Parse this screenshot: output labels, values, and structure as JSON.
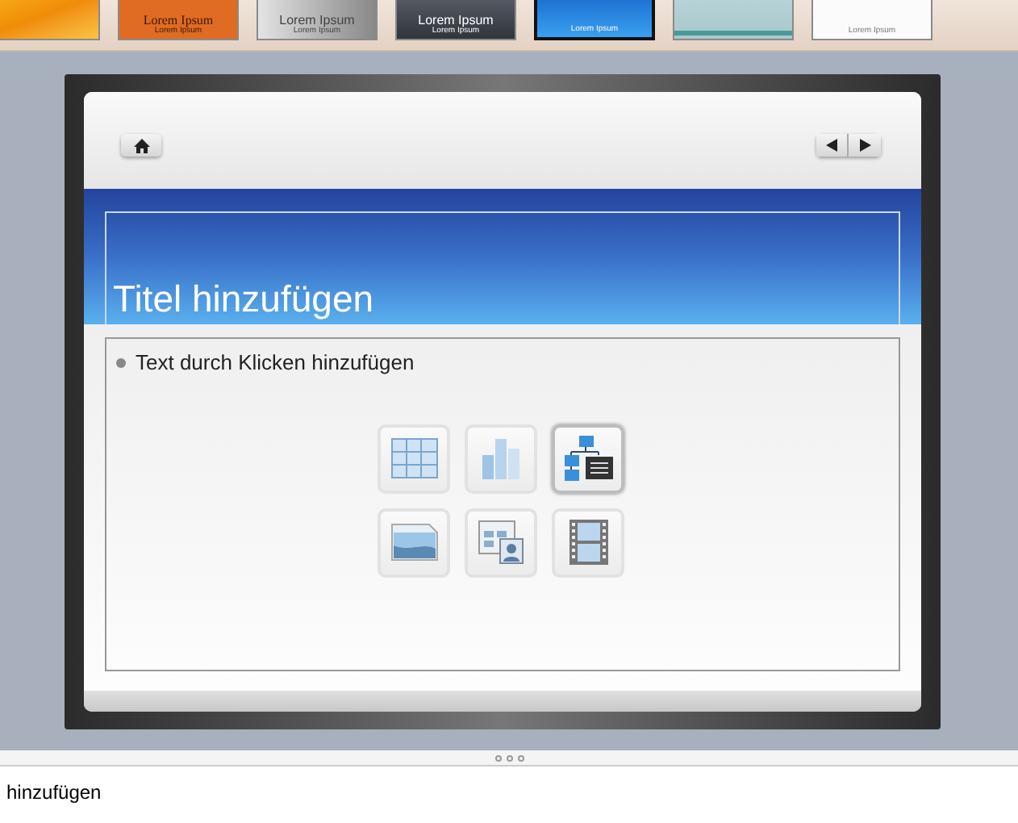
{
  "themes": [
    {
      "kind": "orange-texture",
      "selected": false
    },
    {
      "kind": "orange",
      "lines": [
        "Lorem Ipsum",
        "Lorem Ipsum"
      ],
      "selected": false
    },
    {
      "kind": "grey-photo",
      "lines": [
        "Lorem Ipsum",
        "Lorem Ipsum"
      ],
      "selected": false
    },
    {
      "kind": "dark",
      "lines": [
        "Lorem Ipsum",
        "Lorem Ipsum"
      ],
      "selected": false
    },
    {
      "kind": "blue",
      "lines": [
        "Lorem Ipsum"
      ],
      "selected": true
    },
    {
      "kind": "teal",
      "selected": false
    },
    {
      "kind": "white",
      "lines": [
        "Lorem Ipsum"
      ],
      "selected": false
    }
  ],
  "slide": {
    "title": "Titel hinzufügen",
    "body": "Text durch Klicken hinzufügen",
    "content_icons": [
      {
        "kind": "table",
        "highlighted": false
      },
      {
        "kind": "chart",
        "highlighted": false
      },
      {
        "kind": "smartart",
        "highlighted": true
      },
      {
        "kind": "picture",
        "highlighted": false
      },
      {
        "kind": "clipart",
        "highlighted": false
      },
      {
        "kind": "movie",
        "highlighted": false
      }
    ]
  },
  "notes": {
    "text": "hinzufügen"
  }
}
